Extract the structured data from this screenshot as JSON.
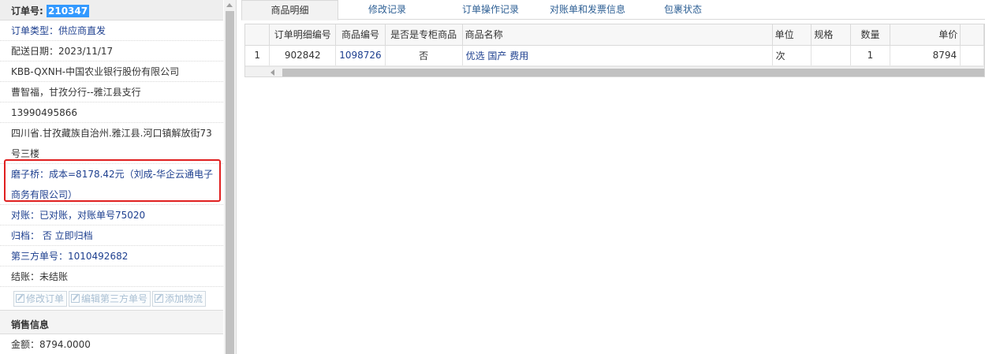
{
  "order": {
    "label": "订单号:",
    "number": "210347"
  },
  "info_rows": [
    {
      "text": "订单类型：供应商直发"
    },
    {
      "text": "配送日期：2023/11/17"
    },
    {
      "text": "KBB-QXNH-中国农业银行股份有限公司"
    },
    {
      "text": "曹智福，甘孜分行--雅江县支行"
    },
    {
      "text": "13990495866"
    },
    {
      "text": "四川省.甘孜藏族自治州.雅江县.河口镇解放街73号三楼"
    },
    {
      "text": "磨子桥：成本=8178.42元（刘成-华企云通电子商务有限公司）"
    },
    {
      "text": "对账：已对账，对账单号75020"
    },
    {
      "text": "归档： 否 立即归档"
    },
    {
      "text": "第三方单号：1010492682"
    },
    {
      "text": "结账：未结账"
    }
  ],
  "buttons": {
    "edit_order": "修改订单",
    "edit_third_party": "编辑第三方单号",
    "add_logistics": "添加物流"
  },
  "sales_section": {
    "title": "销售信息",
    "amount": "金额：8794.0000"
  },
  "tabs": [
    {
      "label": "商品明细",
      "active": true
    },
    {
      "label": "修改记录",
      "active": false
    },
    {
      "label": "订单操作记录",
      "active": false
    },
    {
      "label": "对账单和发票信息",
      "active": false
    },
    {
      "label": "包裹状态",
      "active": false
    }
  ],
  "table": {
    "headers": [
      "订单明细编号",
      "商品编号",
      "是否是专柜商品",
      "商品名称",
      "单位",
      "规格",
      "数量",
      "单价"
    ],
    "rows": [
      {
        "index": "1",
        "detail_id": "902842",
        "product_id": "1098726",
        "counter": "否",
        "name": "优选 国产 费用",
        "unit": "次",
        "spec": "",
        "qty": "1",
        "price": "8794"
      }
    ]
  },
  "colors": {
    "accent": "#3399ff",
    "link": "#1d3f8f",
    "highlight_border": "#e02020"
  }
}
